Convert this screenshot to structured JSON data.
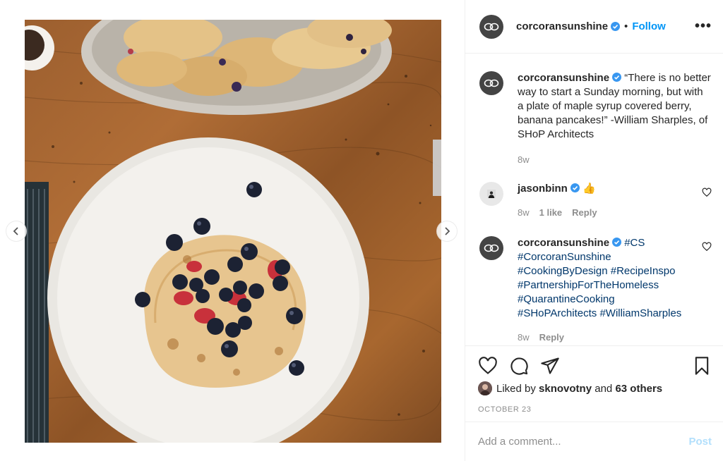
{
  "post": {
    "author": "corcoransunshine",
    "follow_label": "Follow",
    "dot": "•",
    "more_label": "•••"
  },
  "comments": [
    {
      "username": "corcoransunshine",
      "text": "“There is no better way to start a Sunday morning, but with a plate of maple syrup covered berry, banana pancakes!” -William Sharples, of SHoP Architects",
      "time": "8w"
    },
    {
      "username": "jasonbinn",
      "text": "👍",
      "time": "8w",
      "likes": "1 like",
      "reply": "Reply"
    },
    {
      "username": "corcoransunshine",
      "hashtags": [
        "#CS",
        "#CorcoranSunshine",
        "#CookingByDesign",
        "#RecipeInspo",
        "#PartnershipForTheHomeless",
        "#QuarantineCooking",
        "#SHoPArchitects",
        "#WilliamSharples"
      ],
      "time": "8w",
      "reply": "Reply"
    }
  ],
  "likes": {
    "prefix": "Liked by",
    "user": "sknovotny",
    "connector": "and",
    "others": "63 others"
  },
  "date": "OCTOBER 23",
  "add_comment": {
    "placeholder": "Add a comment...",
    "post_label": "Post"
  },
  "colors": {
    "accent": "#0095f6",
    "hashtag": "#00376b",
    "muted": "#8e8e8e",
    "post_disabled": "#b2dffc",
    "verified": "#3897f0"
  },
  "icons": [
    "chevron-left-icon",
    "chevron-right-icon",
    "verified-badge-icon",
    "heart-icon",
    "comment-icon",
    "share-icon",
    "bookmark-icon"
  ]
}
